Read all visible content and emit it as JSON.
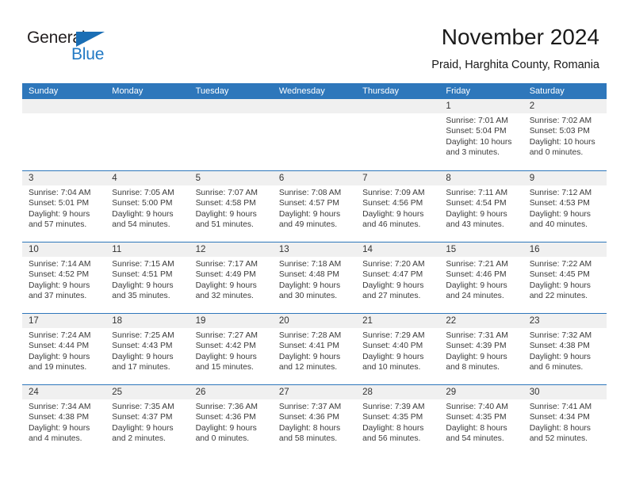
{
  "brand": {
    "name_part1": "General",
    "name_part2": "Blue",
    "accent_color": "#2179c4",
    "triangle_color": "#1a6eb5"
  },
  "header": {
    "title": "November 2024",
    "subtitle": "Praid, Harghita County, Romania"
  },
  "calendar": {
    "header_bg": "#2e77bb",
    "datestrip_bg": "#f0f0f0",
    "weekdays": [
      "Sunday",
      "Monday",
      "Tuesday",
      "Wednesday",
      "Thursday",
      "Friday",
      "Saturday"
    ],
    "weeks": [
      [
        {
          "day": "",
          "sunrise": "",
          "sunset": "",
          "daylight": "",
          "empty": true
        },
        {
          "day": "",
          "sunrise": "",
          "sunset": "",
          "daylight": "",
          "empty": true
        },
        {
          "day": "",
          "sunrise": "",
          "sunset": "",
          "daylight": "",
          "empty": true
        },
        {
          "day": "",
          "sunrise": "",
          "sunset": "",
          "daylight": "",
          "empty": true
        },
        {
          "day": "",
          "sunrise": "",
          "sunset": "",
          "daylight": "",
          "empty": true
        },
        {
          "day": "1",
          "sunrise": "Sunrise: 7:01 AM",
          "sunset": "Sunset: 5:04 PM",
          "daylight": "Daylight: 10 hours and 3 minutes.",
          "empty": false
        },
        {
          "day": "2",
          "sunrise": "Sunrise: 7:02 AM",
          "sunset": "Sunset: 5:03 PM",
          "daylight": "Daylight: 10 hours and 0 minutes.",
          "empty": false
        }
      ],
      [
        {
          "day": "3",
          "sunrise": "Sunrise: 7:04 AM",
          "sunset": "Sunset: 5:01 PM",
          "daylight": "Daylight: 9 hours and 57 minutes.",
          "empty": false
        },
        {
          "day": "4",
          "sunrise": "Sunrise: 7:05 AM",
          "sunset": "Sunset: 5:00 PM",
          "daylight": "Daylight: 9 hours and 54 minutes.",
          "empty": false
        },
        {
          "day": "5",
          "sunrise": "Sunrise: 7:07 AM",
          "sunset": "Sunset: 4:58 PM",
          "daylight": "Daylight: 9 hours and 51 minutes.",
          "empty": false
        },
        {
          "day": "6",
          "sunrise": "Sunrise: 7:08 AM",
          "sunset": "Sunset: 4:57 PM",
          "daylight": "Daylight: 9 hours and 49 minutes.",
          "empty": false
        },
        {
          "day": "7",
          "sunrise": "Sunrise: 7:09 AM",
          "sunset": "Sunset: 4:56 PM",
          "daylight": "Daylight: 9 hours and 46 minutes.",
          "empty": false
        },
        {
          "day": "8",
          "sunrise": "Sunrise: 7:11 AM",
          "sunset": "Sunset: 4:54 PM",
          "daylight": "Daylight: 9 hours and 43 minutes.",
          "empty": false
        },
        {
          "day": "9",
          "sunrise": "Sunrise: 7:12 AM",
          "sunset": "Sunset: 4:53 PM",
          "daylight": "Daylight: 9 hours and 40 minutes.",
          "empty": false
        }
      ],
      [
        {
          "day": "10",
          "sunrise": "Sunrise: 7:14 AM",
          "sunset": "Sunset: 4:52 PM",
          "daylight": "Daylight: 9 hours and 37 minutes.",
          "empty": false
        },
        {
          "day": "11",
          "sunrise": "Sunrise: 7:15 AM",
          "sunset": "Sunset: 4:51 PM",
          "daylight": "Daylight: 9 hours and 35 minutes.",
          "empty": false
        },
        {
          "day": "12",
          "sunrise": "Sunrise: 7:17 AM",
          "sunset": "Sunset: 4:49 PM",
          "daylight": "Daylight: 9 hours and 32 minutes.",
          "empty": false
        },
        {
          "day": "13",
          "sunrise": "Sunrise: 7:18 AM",
          "sunset": "Sunset: 4:48 PM",
          "daylight": "Daylight: 9 hours and 30 minutes.",
          "empty": false
        },
        {
          "day": "14",
          "sunrise": "Sunrise: 7:20 AM",
          "sunset": "Sunset: 4:47 PM",
          "daylight": "Daylight: 9 hours and 27 minutes.",
          "empty": false
        },
        {
          "day": "15",
          "sunrise": "Sunrise: 7:21 AM",
          "sunset": "Sunset: 4:46 PM",
          "daylight": "Daylight: 9 hours and 24 minutes.",
          "empty": false
        },
        {
          "day": "16",
          "sunrise": "Sunrise: 7:22 AM",
          "sunset": "Sunset: 4:45 PM",
          "daylight": "Daylight: 9 hours and 22 minutes.",
          "empty": false
        }
      ],
      [
        {
          "day": "17",
          "sunrise": "Sunrise: 7:24 AM",
          "sunset": "Sunset: 4:44 PM",
          "daylight": "Daylight: 9 hours and 19 minutes.",
          "empty": false
        },
        {
          "day": "18",
          "sunrise": "Sunrise: 7:25 AM",
          "sunset": "Sunset: 4:43 PM",
          "daylight": "Daylight: 9 hours and 17 minutes.",
          "empty": false
        },
        {
          "day": "19",
          "sunrise": "Sunrise: 7:27 AM",
          "sunset": "Sunset: 4:42 PM",
          "daylight": "Daylight: 9 hours and 15 minutes.",
          "empty": false
        },
        {
          "day": "20",
          "sunrise": "Sunrise: 7:28 AM",
          "sunset": "Sunset: 4:41 PM",
          "daylight": "Daylight: 9 hours and 12 minutes.",
          "empty": false
        },
        {
          "day": "21",
          "sunrise": "Sunrise: 7:29 AM",
          "sunset": "Sunset: 4:40 PM",
          "daylight": "Daylight: 9 hours and 10 minutes.",
          "empty": false
        },
        {
          "day": "22",
          "sunrise": "Sunrise: 7:31 AM",
          "sunset": "Sunset: 4:39 PM",
          "daylight": "Daylight: 9 hours and 8 minutes.",
          "empty": false
        },
        {
          "day": "23",
          "sunrise": "Sunrise: 7:32 AM",
          "sunset": "Sunset: 4:38 PM",
          "daylight": "Daylight: 9 hours and 6 minutes.",
          "empty": false
        }
      ],
      [
        {
          "day": "24",
          "sunrise": "Sunrise: 7:34 AM",
          "sunset": "Sunset: 4:38 PM",
          "daylight": "Daylight: 9 hours and 4 minutes.",
          "empty": false
        },
        {
          "day": "25",
          "sunrise": "Sunrise: 7:35 AM",
          "sunset": "Sunset: 4:37 PM",
          "daylight": "Daylight: 9 hours and 2 minutes.",
          "empty": false
        },
        {
          "day": "26",
          "sunrise": "Sunrise: 7:36 AM",
          "sunset": "Sunset: 4:36 PM",
          "daylight": "Daylight: 9 hours and 0 minutes.",
          "empty": false
        },
        {
          "day": "27",
          "sunrise": "Sunrise: 7:37 AM",
          "sunset": "Sunset: 4:36 PM",
          "daylight": "Daylight: 8 hours and 58 minutes.",
          "empty": false
        },
        {
          "day": "28",
          "sunrise": "Sunrise: 7:39 AM",
          "sunset": "Sunset: 4:35 PM",
          "daylight": "Daylight: 8 hours and 56 minutes.",
          "empty": false
        },
        {
          "day": "29",
          "sunrise": "Sunrise: 7:40 AM",
          "sunset": "Sunset: 4:35 PM",
          "daylight": "Daylight: 8 hours and 54 minutes.",
          "empty": false
        },
        {
          "day": "30",
          "sunrise": "Sunrise: 7:41 AM",
          "sunset": "Sunset: 4:34 PM",
          "daylight": "Daylight: 8 hours and 52 minutes.",
          "empty": false
        }
      ]
    ]
  }
}
